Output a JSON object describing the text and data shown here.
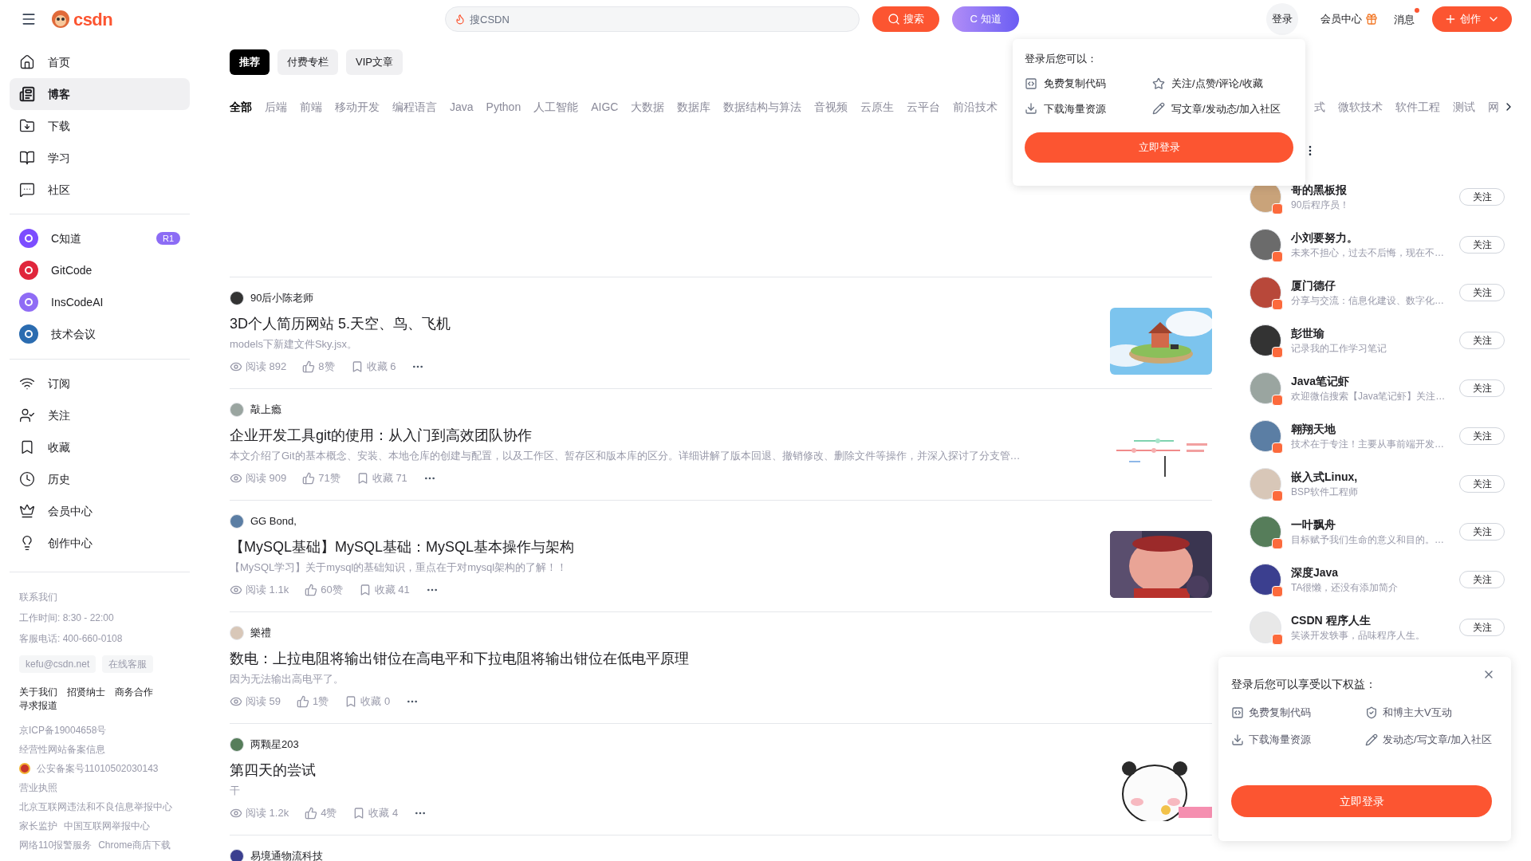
{
  "top_bar": {
    "logo": "csdn",
    "search": {
      "placeholder": "搜CSDN"
    },
    "search_button": "搜索",
    "ai_button": "C 知道",
    "login": "登录",
    "vip": "会员中心",
    "messages": {
      "label": "消息",
      "unread": true
    },
    "create_button": "创作"
  },
  "sidebar": {
    "nav": [
      {
        "label": "首页",
        "selected": false
      },
      {
        "label": "博客",
        "selected": true
      },
      {
        "label": "下载",
        "selected": false
      },
      {
        "label": "学习",
        "selected": false
      },
      {
        "label": "社区",
        "selected": false
      }
    ],
    "apps": [
      {
        "label": "C知道",
        "color": "#7c4dff",
        "badge": "R1"
      },
      {
        "label": "GitCode",
        "color": "#e0263c"
      },
      {
        "label": "InsCodeAI",
        "color": "#8f6cf5"
      },
      {
        "label": "技术会议",
        "color": "#2b6cb0"
      }
    ],
    "personal": [
      {
        "label": "订阅"
      },
      {
        "label": "关注"
      },
      {
        "label": "收藏"
      },
      {
        "label": "历史"
      },
      {
        "label": "会员中心"
      },
      {
        "label": "创作中心"
      }
    ],
    "footer": {
      "contact": [
        "联系我们",
        "工作时间: 8:30 - 22:00",
        "客服电话: 400-660-0108"
      ],
      "chips": [
        "kefu@csdn.net",
        "在线客服"
      ],
      "links": [
        "关于我们",
        "招贤纳士",
        "商务合作",
        "寻求报道"
      ],
      "records": [
        {
          "kind": "plain",
          "texts": [
            "京ICP备19004658号"
          ]
        },
        {
          "kind": "plain",
          "texts": [
            "经营性网站备案信息"
          ]
        },
        {
          "kind": "badge",
          "texts": [
            "公安备案号11010502030143"
          ]
        },
        {
          "kind": "plain",
          "texts": [
            "营业执照"
          ]
        },
        {
          "kind": "plain",
          "texts": [
            "北京互联网违法和不良信息举报中心"
          ]
        },
        {
          "kind": "plain",
          "texts": [
            "家长监护",
            "中国互联网举报中心"
          ]
        },
        {
          "kind": "plain",
          "texts": [
            "网络110报警服务",
            "Chrome商店下载"
          ]
        }
      ]
    }
  },
  "feed_tabs": [
    {
      "label": "推荐",
      "selected": true
    },
    {
      "label": "付费专栏",
      "selected": false
    },
    {
      "label": "VIP文章",
      "selected": false
    }
  ],
  "categories": {
    "visible_start": [
      {
        "label": "全部",
        "selected": true
      },
      {
        "label": "后端",
        "selected": false
      },
      {
        "label": "前端",
        "selected": false
      },
      {
        "label": "移动开发",
        "selected": false
      },
      {
        "label": "编程语言",
        "selected": false
      },
      {
        "label": "Java",
        "selected": false
      },
      {
        "label": "Python",
        "selected": false
      },
      {
        "label": "人工智能",
        "selected": false
      },
      {
        "label": "AIGC",
        "selected": false
      },
      {
        "label": "大数据",
        "selected": false
      },
      {
        "label": "数据库",
        "selected": false
      },
      {
        "label": "数据结构与算法",
        "selected": false
      },
      {
        "label": "音视频",
        "selected": false
      },
      {
        "label": "云原生",
        "selected": false
      },
      {
        "label": "云平台",
        "selected": false
      },
      {
        "label": "前沿技术",
        "selected": false
      }
    ],
    "visible_end": [
      {
        "label": "式",
        "selected": false
      },
      {
        "label": "微软技术",
        "selected": false
      },
      {
        "label": "软件工程",
        "selected": false
      },
      {
        "label": "测试",
        "selected": false
      },
      {
        "label": "网",
        "selected": false
      }
    ]
  },
  "articles": [
    {
      "author": "90后小陈老师",
      "title": "3D个人简历网站 5.天空、鸟、飞机",
      "summary": "models下新建文件Sky.jsx。",
      "reads": "阅读 892",
      "likes": "8赞",
      "saves": "收藏 6"
    },
    {
      "author": "敲上瘾",
      "title": "企业开发工具git的使用：从入门到高效团队协作",
      "summary": "本文介绍了Git的基本概念、安装、本地仓库的创建与配置，以及工作区、暂存区和版本库的区分。详细讲解了版本回退、撤销修改、删除文件等操作，并深入探讨了分支管…",
      "reads": "阅读 909",
      "likes": "71赞",
      "saves": "收藏 71"
    },
    {
      "author": "GG Bond,",
      "title": "【MySQL基础】MySQL基础：MySQL基本操作与架构",
      "summary": "【MySQL学习】关于mysql的基础知识，重点在于对mysql架构的了解！！",
      "reads": "阅读 1.1k",
      "likes": "60赞",
      "saves": "收藏 41"
    },
    {
      "author": "樂禮",
      "title": "数电：上拉电阻将输出钳位在高电平和下拉电阻将输出钳位在低电平原理",
      "summary": "因为无法输出高电平了。",
      "reads": "阅读 59",
      "likes": "1赞",
      "saves": "收藏 0"
    },
    {
      "author": "两颗星203",
      "title": "第四天的尝试",
      "summary": "干",
      "reads": "阅读 1.2k",
      "likes": "4赞",
      "saves": "收藏 4"
    },
    {
      "author": "易境通物流科技"
    }
  ],
  "login_popup": {
    "title": "登录后您可以：",
    "perks": [
      {
        "kind": "code",
        "label": "免费复制代码"
      },
      {
        "kind": "star",
        "label": "关注/点赞/评论/收藏"
      },
      {
        "kind": "download",
        "label": "下载海量资源"
      },
      {
        "kind": "pencil",
        "label": "写文章/发动态/加入社区"
      }
    ],
    "button": "立即登录"
  },
  "recommended_authors": [
    {
      "name": "哥的黑板报",
      "bio": "90后程序员！",
      "button": "关注"
    },
    {
      "name": "小刘要努力。",
      "bio": "未来不担心，过去不后悔，现在不…",
      "button": "关注"
    },
    {
      "name": "厦门德仔",
      "bio": "分享与交流：信息化建设、数字化…",
      "button": "关注"
    },
    {
      "name": "彭世瑜",
      "bio": "记录我的工作学习笔记",
      "button": "关注"
    },
    {
      "name": "Java笔记虾",
      "bio": "欢迎微信搜索【Java笔记虾】关注…",
      "button": "关注"
    },
    {
      "name": "翱翔天地",
      "bio": "技术在于专注！主要从事前端开发…",
      "button": "关注"
    },
    {
      "name": "嵌入式Linux,",
      "bio": "BSP软件工程师",
      "button": "关注"
    },
    {
      "name": "一叶飘舟",
      "bio": "目标赋予我们生命的意义和目的。…",
      "button": "关注"
    },
    {
      "name": "深度Java",
      "bio": "TA很懒，还没有添加简介",
      "button": "关注"
    },
    {
      "name": "CSDN 程序人生",
      "bio": "笑谈开发轶事，品味程序人生。",
      "button": "关注"
    }
  ],
  "benefits_popup": {
    "title": "登录后您可以享受以下权益：",
    "perks": [
      {
        "kind": "code",
        "label": "免费复制代码"
      },
      {
        "kind": "vbadge",
        "label": "和博主大V互动"
      },
      {
        "kind": "download",
        "label": "下载海量资源"
      },
      {
        "kind": "pencil",
        "label": "发动态/写文章/加入社区"
      }
    ],
    "button": "立即登录"
  }
}
